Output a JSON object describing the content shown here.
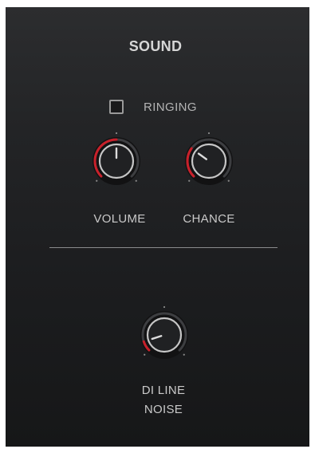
{
  "section_title": "SOUND",
  "ringing": {
    "label": "RINGING",
    "checked": false
  },
  "volume": {
    "label": "VOLUME",
    "value": 0.5,
    "accent_color": "#c8202a"
  },
  "chance": {
    "label": "CHANCE",
    "value": 0.3,
    "accent_color": "#c8202a"
  },
  "di_line_noise": {
    "label_line1": "DI LINE",
    "label_line2": "NOISE",
    "value": 0.1,
    "accent_color": "#c8202a"
  }
}
